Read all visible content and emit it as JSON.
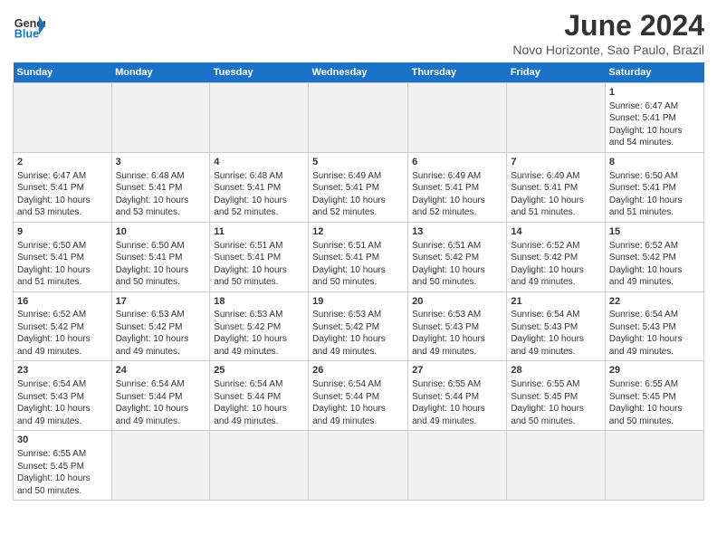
{
  "header": {
    "logo_general": "General",
    "logo_blue": "Blue",
    "title": "June 2024",
    "location": "Novo Horizonte, Sao Paulo, Brazil"
  },
  "days_of_week": [
    "Sunday",
    "Monday",
    "Tuesday",
    "Wednesday",
    "Thursday",
    "Friday",
    "Saturday"
  ],
  "weeks": [
    [
      {
        "day": "",
        "info": "",
        "empty": true
      },
      {
        "day": "",
        "info": "",
        "empty": true
      },
      {
        "day": "",
        "info": "",
        "empty": true
      },
      {
        "day": "",
        "info": "",
        "empty": true
      },
      {
        "day": "",
        "info": "",
        "empty": true
      },
      {
        "day": "",
        "info": "",
        "empty": true
      },
      {
        "day": "1",
        "info": "Sunrise: 6:47 AM\nSunset: 5:41 PM\nDaylight: 10 hours\nand 54 minutes."
      }
    ],
    [
      {
        "day": "2",
        "info": "Sunrise: 6:47 AM\nSunset: 5:41 PM\nDaylight: 10 hours\nand 53 minutes."
      },
      {
        "day": "3",
        "info": "Sunrise: 6:48 AM\nSunset: 5:41 PM\nDaylight: 10 hours\nand 53 minutes."
      },
      {
        "day": "4",
        "info": "Sunrise: 6:48 AM\nSunset: 5:41 PM\nDaylight: 10 hours\nand 52 minutes."
      },
      {
        "day": "5",
        "info": "Sunrise: 6:49 AM\nSunset: 5:41 PM\nDaylight: 10 hours\nand 52 minutes."
      },
      {
        "day": "6",
        "info": "Sunrise: 6:49 AM\nSunset: 5:41 PM\nDaylight: 10 hours\nand 52 minutes."
      },
      {
        "day": "7",
        "info": "Sunrise: 6:49 AM\nSunset: 5:41 PM\nDaylight: 10 hours\nand 51 minutes."
      },
      {
        "day": "8",
        "info": "Sunrise: 6:50 AM\nSunset: 5:41 PM\nDaylight: 10 hours\nand 51 minutes."
      }
    ],
    [
      {
        "day": "9",
        "info": "Sunrise: 6:50 AM\nSunset: 5:41 PM\nDaylight: 10 hours\nand 51 minutes."
      },
      {
        "day": "10",
        "info": "Sunrise: 6:50 AM\nSunset: 5:41 PM\nDaylight: 10 hours\nand 50 minutes."
      },
      {
        "day": "11",
        "info": "Sunrise: 6:51 AM\nSunset: 5:41 PM\nDaylight: 10 hours\nand 50 minutes."
      },
      {
        "day": "12",
        "info": "Sunrise: 6:51 AM\nSunset: 5:41 PM\nDaylight: 10 hours\nand 50 minutes."
      },
      {
        "day": "13",
        "info": "Sunrise: 6:51 AM\nSunset: 5:42 PM\nDaylight: 10 hours\nand 50 minutes."
      },
      {
        "day": "14",
        "info": "Sunrise: 6:52 AM\nSunset: 5:42 PM\nDaylight: 10 hours\nand 49 minutes."
      },
      {
        "day": "15",
        "info": "Sunrise: 6:52 AM\nSunset: 5:42 PM\nDaylight: 10 hours\nand 49 minutes."
      }
    ],
    [
      {
        "day": "16",
        "info": "Sunrise: 6:52 AM\nSunset: 5:42 PM\nDaylight: 10 hours\nand 49 minutes."
      },
      {
        "day": "17",
        "info": "Sunrise: 6:53 AM\nSunset: 5:42 PM\nDaylight: 10 hours\nand 49 minutes."
      },
      {
        "day": "18",
        "info": "Sunrise: 6:53 AM\nSunset: 5:42 PM\nDaylight: 10 hours\nand 49 minutes."
      },
      {
        "day": "19",
        "info": "Sunrise: 6:53 AM\nSunset: 5:42 PM\nDaylight: 10 hours\nand 49 minutes."
      },
      {
        "day": "20",
        "info": "Sunrise: 6:53 AM\nSunset: 5:43 PM\nDaylight: 10 hours\nand 49 minutes."
      },
      {
        "day": "21",
        "info": "Sunrise: 6:54 AM\nSunset: 5:43 PM\nDaylight: 10 hours\nand 49 minutes."
      },
      {
        "day": "22",
        "info": "Sunrise: 6:54 AM\nSunset: 5:43 PM\nDaylight: 10 hours\nand 49 minutes."
      }
    ],
    [
      {
        "day": "23",
        "info": "Sunrise: 6:54 AM\nSunset: 5:43 PM\nDaylight: 10 hours\nand 49 minutes."
      },
      {
        "day": "24",
        "info": "Sunrise: 6:54 AM\nSunset: 5:44 PM\nDaylight: 10 hours\nand 49 minutes."
      },
      {
        "day": "25",
        "info": "Sunrise: 6:54 AM\nSunset: 5:44 PM\nDaylight: 10 hours\nand 49 minutes."
      },
      {
        "day": "26",
        "info": "Sunrise: 6:54 AM\nSunset: 5:44 PM\nDaylight: 10 hours\nand 49 minutes."
      },
      {
        "day": "27",
        "info": "Sunrise: 6:55 AM\nSunset: 5:44 PM\nDaylight: 10 hours\nand 49 minutes."
      },
      {
        "day": "28",
        "info": "Sunrise: 6:55 AM\nSunset: 5:45 PM\nDaylight: 10 hours\nand 50 minutes."
      },
      {
        "day": "29",
        "info": "Sunrise: 6:55 AM\nSunset: 5:45 PM\nDaylight: 10 hours\nand 50 minutes."
      }
    ],
    [
      {
        "day": "30",
        "info": "Sunrise: 6:55 AM\nSunset: 5:45 PM\nDaylight: 10 hours\nand 50 minutes.",
        "lastrow": true
      },
      {
        "day": "",
        "info": "",
        "empty": true,
        "lastrow": true
      },
      {
        "day": "",
        "info": "",
        "empty": true,
        "lastrow": true
      },
      {
        "day": "",
        "info": "",
        "empty": true,
        "lastrow": true
      },
      {
        "day": "",
        "info": "",
        "empty": true,
        "lastrow": true
      },
      {
        "day": "",
        "info": "",
        "empty": true,
        "lastrow": true
      },
      {
        "day": "",
        "info": "",
        "empty": true,
        "lastrow": true
      }
    ]
  ]
}
